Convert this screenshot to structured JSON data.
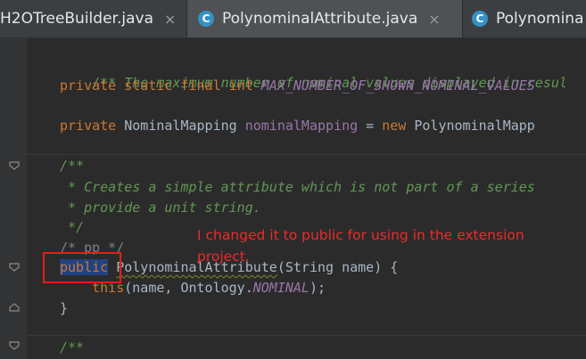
{
  "tabs": [
    {
      "label": "H2OTreeBuilder.java",
      "close": "×",
      "active": false,
      "icon": null
    },
    {
      "label": "PolynominalAttribute.java",
      "close": "×",
      "active": true,
      "icon": "C"
    },
    {
      "label": "Polynomina",
      "close": "",
      "active": false,
      "icon": "C"
    }
  ],
  "code": {
    "l1": "/** The maximum number of nominal values displayed in resul",
    "l2": {
      "kw": "private static final int ",
      "const": "MAX_NUMBER_OF_SHOWN_NOMINAL_VALUES"
    },
    "l3": {
      "kw": "private ",
      "type": "NominalMapping ",
      "field": "nominalMapping",
      "eq": " = ",
      "kw2": "new ",
      "rest": "PolynominalMapp"
    },
    "l4": "/**",
    "l5": " * Creates a simple attribute which is not part of a series",
    "l6": " * provide a unit string.",
    "l7": " */",
    "l8": "/* pp */",
    "l9": {
      "kw": "public",
      "space": " ",
      "name": "PolynominalAttribute",
      "rest": "(String name) {"
    },
    "l10": {
      "indent": "    ",
      "kw": "this",
      "rest1": "(name, Ontology.",
      "const": "NOMINAL",
      "rest2": ");"
    },
    "l11": "}",
    "l12": "/**"
  },
  "annotation": {
    "text": "I changed it to public for using in the extension project.",
    "color": "#ef2a2a"
  },
  "colors": {
    "background": "#2b2b2b",
    "keyword": "#cc7832",
    "comment": "#629755",
    "constant": "#9876aa",
    "text": "#a9b7c6",
    "selection": "#214283"
  }
}
